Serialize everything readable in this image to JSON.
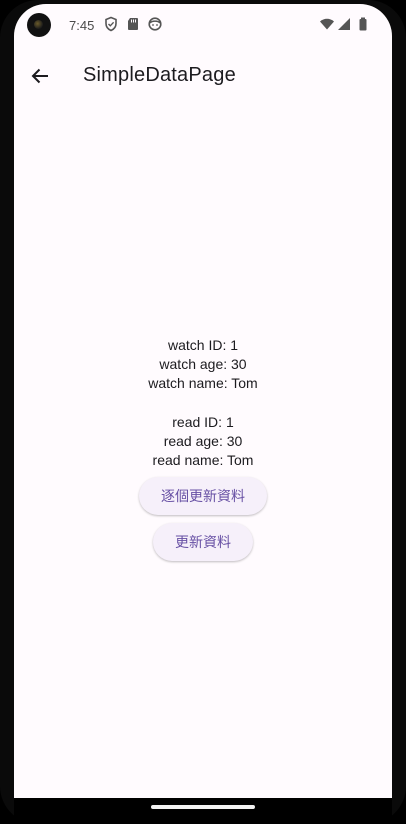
{
  "status_bar": {
    "time": "7:45",
    "left_icons": [
      "shield-icon",
      "sd-card-icon",
      "face-icon"
    ],
    "right_icons": [
      "wifi-icon",
      "signal-icon",
      "battery-icon"
    ]
  },
  "app_bar": {
    "back_icon": "arrow-back-icon",
    "title": "SimpleDataPage"
  },
  "watch": {
    "id_text": "watch ID: 1",
    "age_text": "watch age: 30",
    "name_text": "watch name: Tom"
  },
  "read": {
    "id_text": "read ID: 1",
    "age_text": "read age: 30",
    "name_text": "read name: Tom"
  },
  "buttons": {
    "update_each_label": "逐個更新資料",
    "update_label": "更新資料"
  },
  "colors": {
    "background": "#fffbfe",
    "button_bg": "#f6f0fa",
    "button_text": "#6750a4"
  }
}
